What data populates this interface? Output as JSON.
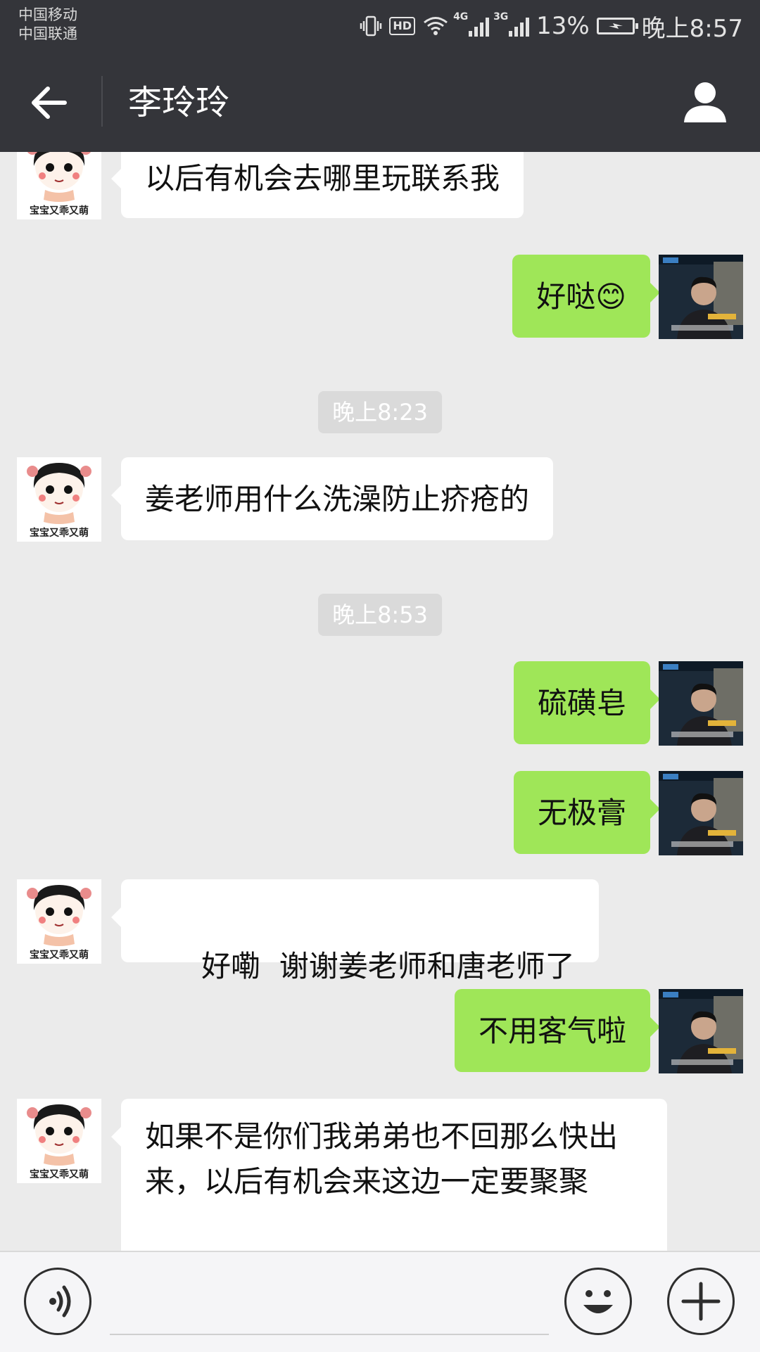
{
  "status": {
    "carrier1": "中国移动",
    "carrier2": "中国联通",
    "net1": "4G",
    "net2": "3G",
    "hd": "HD",
    "battery": "13%",
    "time": "晚上8:57"
  },
  "header": {
    "title": "李玲玲",
    "back_icon": "arrow-left-icon",
    "profile_icon": "person-icon"
  },
  "avatar_caption": "宝宝又乖又萌",
  "messages": [
    {
      "type": "in",
      "text": "以后有机会去哪里玩联系我"
    },
    {
      "type": "out",
      "text": "好哒😊"
    },
    {
      "type": "time",
      "text": "晚上8:23"
    },
    {
      "type": "in",
      "text": "姜老师用什么洗澡防止疥疮的"
    },
    {
      "type": "time",
      "text": "晚上8:53"
    },
    {
      "type": "out",
      "text": "硫磺皂"
    },
    {
      "type": "out",
      "text": "无极膏"
    },
    {
      "type": "in",
      "text": "好嘞  谢谢姜老师和唐老师了"
    },
    {
      "type": "out",
      "text": "不用客气啦"
    },
    {
      "type": "in",
      "text": "如果不是你们我弟弟也不回那么快出来，以后有机会来这边一定要聚聚"
    }
  ],
  "inputbar": {
    "voice_icon": "voice-icon",
    "emoji_icon": "emoji-icon",
    "plus_icon": "plus-icon"
  },
  "colors": {
    "titlebar": "#34353a",
    "background": "#ebebeb",
    "out_bubble": "#9fe658",
    "in_bubble": "#ffffff"
  }
}
